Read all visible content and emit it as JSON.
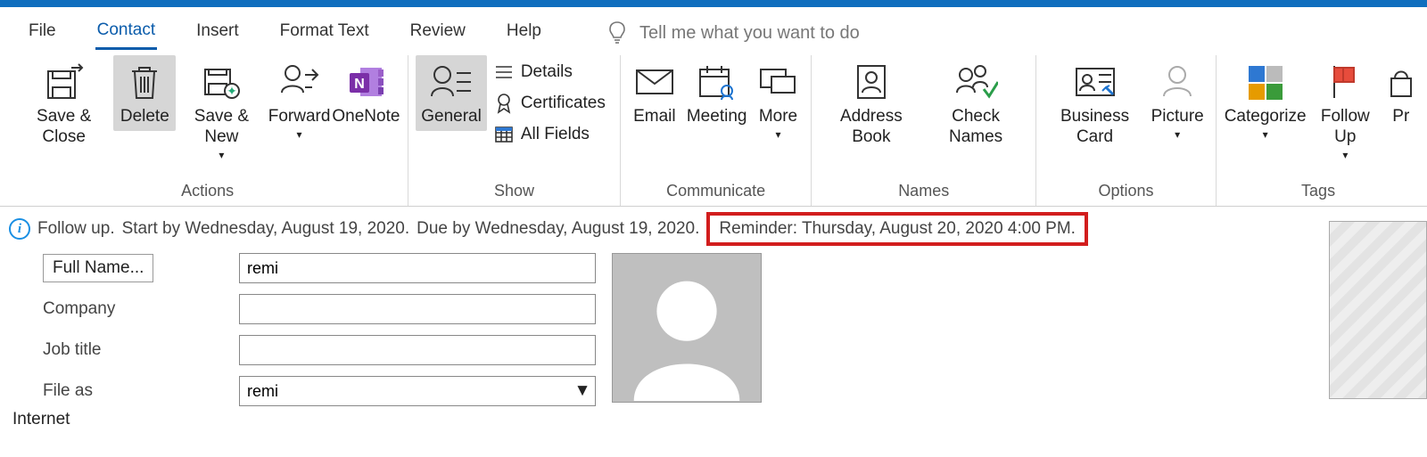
{
  "tabs": {
    "file": "File",
    "contact": "Contact",
    "insert": "Insert",
    "format_text": "Format Text",
    "review": "Review",
    "help": "Help"
  },
  "tellme_placeholder": "Tell me what you want to do",
  "ribbon": {
    "actions": {
      "label": "Actions",
      "save_close": "Save & Close",
      "delete": "Delete",
      "save_new": "Save & New",
      "forward": "Forward",
      "onenote": "OneNote"
    },
    "show": {
      "label": "Show",
      "general": "General",
      "details": "Details",
      "certificates": "Certificates",
      "all_fields": "All Fields"
    },
    "communicate": {
      "label": "Communicate",
      "email": "Email",
      "meeting": "Meeting",
      "more": "More"
    },
    "names": {
      "label": "Names",
      "address_book": "Address Book",
      "check_names": "Check Names"
    },
    "options": {
      "label": "Options",
      "business_card": "Business Card",
      "picture": "Picture"
    },
    "tags": {
      "label": "Tags",
      "categorize": "Categorize",
      "follow_up": "Follow Up",
      "private": "Pr"
    }
  },
  "info_bar": {
    "followup": "Follow up.",
    "start": "Start by Wednesday, August 19, 2020.",
    "due": "Due by Wednesday, August 19, 2020.",
    "reminder": "Reminder: Thursday, August 20, 2020 4:00 PM."
  },
  "form": {
    "full_name_btn": "Full Name...",
    "full_name_value": "remi",
    "company_label": "Company",
    "company_value": "",
    "job_title_label": "Job title",
    "job_title_value": "",
    "file_as_label": "File as",
    "file_as_value": "remi",
    "internet_header": "Internet"
  }
}
